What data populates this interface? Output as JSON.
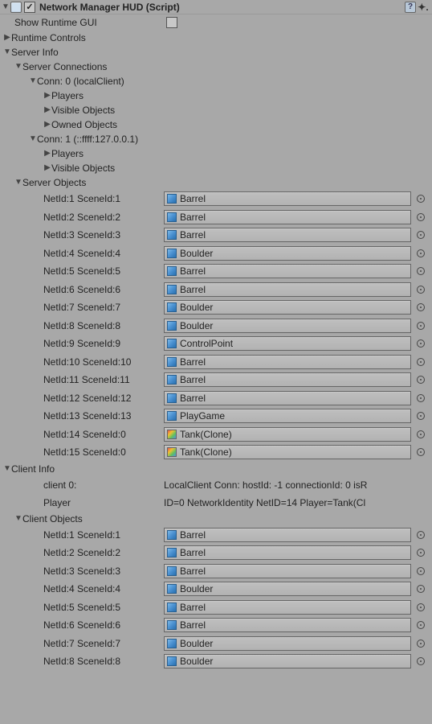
{
  "header": {
    "title": "Network Manager HUD (Script)",
    "enabled": true
  },
  "showRuntimeGui": {
    "label": "Show Runtime GUI",
    "checked": false
  },
  "runtimeControls": {
    "label": "Runtime Controls"
  },
  "serverInfo": {
    "label": "Server Info"
  },
  "serverConnections": {
    "label": "Server Connections",
    "items": [
      {
        "label": "Conn: 0 (localClient)",
        "open": true,
        "children": [
          {
            "label": "Players"
          },
          {
            "label": "Visible Objects"
          },
          {
            "label": "Owned Objects"
          }
        ]
      },
      {
        "label": "Conn: 1 (::ffff:127.0.0.1)",
        "open": true,
        "children": [
          {
            "label": "Players"
          },
          {
            "label": "Visible Objects"
          }
        ]
      }
    ]
  },
  "serverObjects": {
    "label": "Server Objects",
    "items": [
      {
        "id": "NetId:1 SceneId:1",
        "name": "Barrel",
        "cube": "blue"
      },
      {
        "id": "NetId:2 SceneId:2",
        "name": "Barrel",
        "cube": "blue"
      },
      {
        "id": "NetId:3 SceneId:3",
        "name": "Barrel",
        "cube": "blue"
      },
      {
        "id": "NetId:4 SceneId:4",
        "name": "Boulder",
        "cube": "blue"
      },
      {
        "id": "NetId:5 SceneId:5",
        "name": "Barrel",
        "cube": "blue"
      },
      {
        "id": "NetId:6 SceneId:6",
        "name": "Barrel",
        "cube": "blue"
      },
      {
        "id": "NetId:7 SceneId:7",
        "name": "Boulder",
        "cube": "blue"
      },
      {
        "id": "NetId:8 SceneId:8",
        "name": "Boulder",
        "cube": "blue"
      },
      {
        "id": "NetId:9 SceneId:9",
        "name": "ControlPoint",
        "cube": "blue"
      },
      {
        "id": "NetId:10 SceneId:10",
        "name": "Barrel",
        "cube": "blue"
      },
      {
        "id": "NetId:11 SceneId:11",
        "name": "Barrel",
        "cube": "blue"
      },
      {
        "id": "NetId:12 SceneId:12",
        "name": "Barrel",
        "cube": "blue"
      },
      {
        "id": "NetId:13 SceneId:13",
        "name": "PlayGame",
        "cube": "blue"
      },
      {
        "id": "NetId:14 SceneId:0",
        "name": "Tank(Clone)",
        "cube": "multi"
      },
      {
        "id": "NetId:15 SceneId:0",
        "name": "Tank(Clone)",
        "cube": "multi"
      }
    ]
  },
  "clientInfo": {
    "label": "Client Info",
    "client0": {
      "label": "client 0:",
      "value": "LocalClient Conn: hostId: -1 connectionId: 0 isR"
    },
    "player": {
      "label": "Player",
      "value": "ID=0 NetworkIdentity NetID=14 Player=Tank(Cl"
    }
  },
  "clientObjects": {
    "label": "Client Objects",
    "items": [
      {
        "id": "NetId:1 SceneId:1",
        "name": "Barrel",
        "cube": "blue"
      },
      {
        "id": "NetId:2 SceneId:2",
        "name": "Barrel",
        "cube": "blue"
      },
      {
        "id": "NetId:3 SceneId:3",
        "name": "Barrel",
        "cube": "blue"
      },
      {
        "id": "NetId:4 SceneId:4",
        "name": "Boulder",
        "cube": "blue"
      },
      {
        "id": "NetId:5 SceneId:5",
        "name": "Barrel",
        "cube": "blue"
      },
      {
        "id": "NetId:6 SceneId:6",
        "name": "Barrel",
        "cube": "blue"
      },
      {
        "id": "NetId:7 SceneId:7",
        "name": "Boulder",
        "cube": "blue"
      },
      {
        "id": "NetId:8 SceneId:8",
        "name": "Boulder",
        "cube": "blue"
      }
    ]
  }
}
